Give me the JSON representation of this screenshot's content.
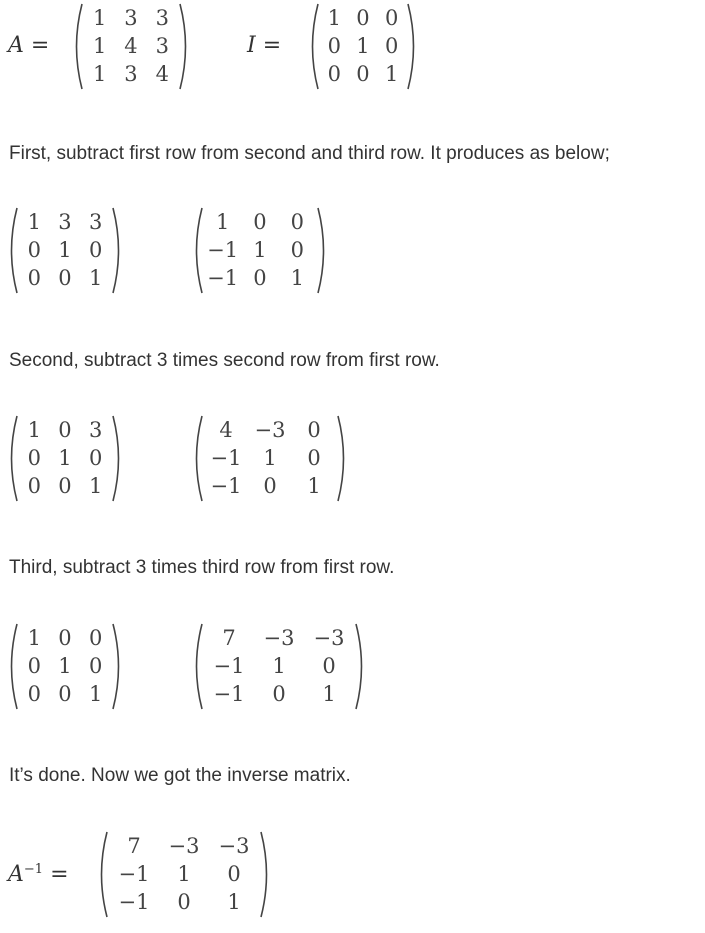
{
  "top": {
    "a_label": "A",
    "i_label": "I",
    "equals": "=",
    "A": [
      [
        "1",
        "3",
        "3"
      ],
      [
        "1",
        "4",
        "3"
      ],
      [
        "1",
        "3",
        "4"
      ]
    ],
    "I": [
      [
        "1",
        "0",
        "0"
      ],
      [
        "0",
        "1",
        "0"
      ],
      [
        "0",
        "0",
        "1"
      ]
    ]
  },
  "steps": [
    {
      "text": "First, subtract first row from second and third row. It produces as below;",
      "left": [
        [
          "1",
          "3",
          "3"
        ],
        [
          "0",
          "1",
          "0"
        ],
        [
          "0",
          "0",
          "1"
        ]
      ],
      "right": [
        [
          "1",
          "0",
          "0"
        ],
        [
          "−1",
          "1",
          "0"
        ],
        [
          "−1",
          "0",
          "1"
        ]
      ]
    },
    {
      "text": "Second, subtract 3 times second row from first row.",
      "left": [
        [
          "1",
          "0",
          "3"
        ],
        [
          "0",
          "1",
          "0"
        ],
        [
          "0",
          "0",
          "1"
        ]
      ],
      "right": [
        [
          "4",
          "−3",
          "0"
        ],
        [
          "−1",
          "1",
          "0"
        ],
        [
          "−1",
          "0",
          "1"
        ]
      ]
    },
    {
      "text": "Third, subtract 3 times third row from first row.",
      "left": [
        [
          "1",
          "0",
          "0"
        ],
        [
          "0",
          "1",
          "0"
        ],
        [
          "0",
          "0",
          "1"
        ]
      ],
      "right": [
        [
          "7",
          "−3",
          "−3"
        ],
        [
          "−1",
          "1",
          "0"
        ],
        [
          "−1",
          "0",
          "1"
        ]
      ]
    }
  ],
  "conclusion": "It’s done. Now we got the inverse matrix.",
  "inverse": {
    "label": "A",
    "superscript": "−1",
    "equals": "=",
    "matrix": [
      [
        "7",
        "−3",
        "−3"
      ],
      [
        "−1",
        "1",
        "0"
      ],
      [
        "−1",
        "0",
        "1"
      ]
    ]
  }
}
